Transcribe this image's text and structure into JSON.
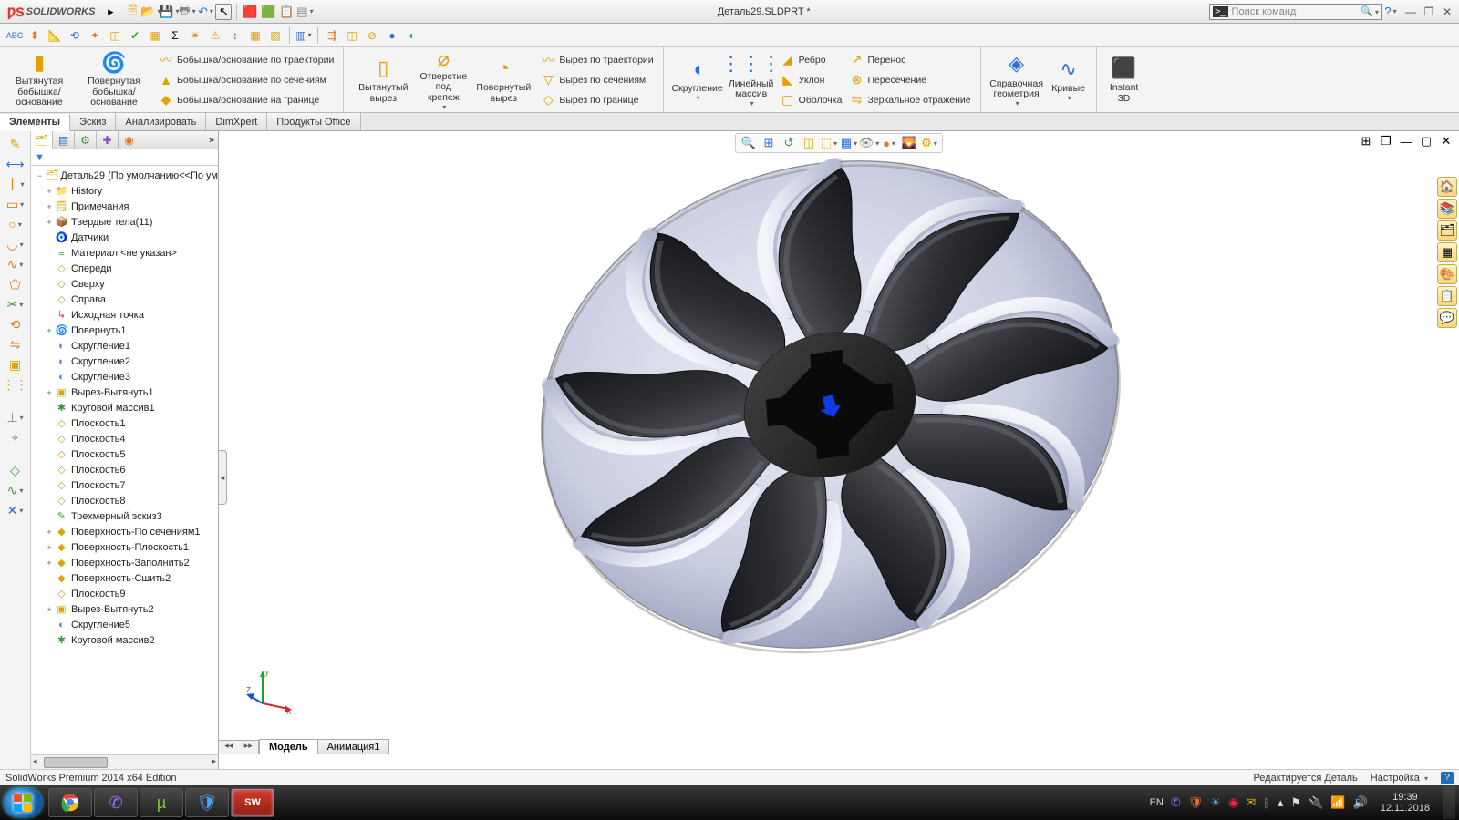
{
  "app": {
    "brand": "SOLIDWORKS",
    "document_title": "Деталь29.SLDPRT *",
    "search_placeholder": "Поиск команд"
  },
  "ribbon": {
    "big": {
      "extrude_boss": "Вытянутая\nбобышка/основание",
      "revolve_boss": "Повернутая\nбобышка/основание",
      "extrude_cut": "Вытянутый\nвырез",
      "hole": "Отверстие\nпод\nкрепеж",
      "revolve_cut": "Повернутый\nвырез",
      "fillet": "Скругление",
      "lpattern": "Линейный\nмассив",
      "ref_geom": "Справочная\nгеометрия",
      "curves": "Кривые",
      "instant3d": "Instant\n3D"
    },
    "boss_col": {
      "swept": "Бобышка/основание по траектории",
      "loft": "Бобышка/основание по сечениям",
      "boundary": "Бобышка/основание на границе"
    },
    "cut_col": {
      "swept": "Вырез по траектории",
      "loft": "Вырез по сечениям",
      "boundary": "Вырез по границе"
    },
    "feat_col": {
      "rib": "Ребро",
      "draft": "Уклон",
      "shell": "Оболочка"
    },
    "feat_col2": {
      "move": "Перенос",
      "intersect": "Пересечение",
      "mirror": "Зеркальное отражение"
    }
  },
  "tabs": {
    "list": [
      "Элементы",
      "Эскиз",
      "Анализировать",
      "DimXpert",
      "Продукты Office"
    ],
    "active": 0
  },
  "tree": {
    "root": "Деталь29  (По умолчанию<<По ум",
    "nodes": [
      {
        "exp": "+",
        "ico": "📁",
        "col": "c-b",
        "label": "History"
      },
      {
        "exp": "+",
        "ico": "🗒",
        "col": "c-y",
        "label": "Примечания"
      },
      {
        "exp": "+",
        "ico": "📦",
        "col": "c-y",
        "label": "Твердые тела(11)"
      },
      {
        "exp": "",
        "ico": "🧿",
        "col": "c-gr",
        "label": "Датчики"
      },
      {
        "exp": "",
        "ico": "≡",
        "col": "c-g",
        "label": "Материал <не указан>"
      },
      {
        "exp": "",
        "ico": "◇",
        "col": "c-plane",
        "label": "Спереди"
      },
      {
        "exp": "",
        "ico": "◇",
        "col": "c-plane",
        "label": "Сверху"
      },
      {
        "exp": "",
        "ico": "◇",
        "col": "c-plane",
        "label": "Справа"
      },
      {
        "exp": "",
        "ico": "↳",
        "col": "c-r",
        "label": "Исходная точка"
      },
      {
        "exp": "+",
        "ico": "🌀",
        "col": "c-feat",
        "label": "Повернуть1"
      },
      {
        "exp": "",
        "ico": "◐",
        "col": "c-feat",
        "label": "Скругление1"
      },
      {
        "exp": "",
        "ico": "◐",
        "col": "c-feat",
        "label": "Скругление2"
      },
      {
        "exp": "",
        "ico": "◐",
        "col": "c-feat",
        "label": "Скругление3"
      },
      {
        "exp": "+",
        "ico": "▣",
        "col": "c-y",
        "label": "Вырез-Вытянуть1"
      },
      {
        "exp": "",
        "ico": "✱",
        "col": "c-patt",
        "label": "Круговой массив1"
      },
      {
        "exp": "",
        "ico": "◇",
        "col": "c-plane",
        "label": "Плоскость1"
      },
      {
        "exp": "",
        "ico": "◇",
        "col": "c-plane",
        "label": "Плоскость4"
      },
      {
        "exp": "",
        "ico": "◇",
        "col": "c-plane",
        "label": "Плоскость5"
      },
      {
        "exp": "",
        "ico": "◇",
        "col": "c-plane",
        "label": "Плоскость6"
      },
      {
        "exp": "",
        "ico": "◇",
        "col": "c-plane",
        "label": "Плоскость7"
      },
      {
        "exp": "",
        "ico": "◇",
        "col": "c-plane",
        "label": "Плоскость8"
      },
      {
        "exp": "",
        "ico": "✎",
        "col": "c-g",
        "label": "Трехмерный эскиз3"
      },
      {
        "exp": "+",
        "ico": "◆",
        "col": "c-y",
        "label": "Поверхность-По сечениям1"
      },
      {
        "exp": "+",
        "ico": "◆",
        "col": "c-y",
        "label": "Поверхность-Плоскость1"
      },
      {
        "exp": "+",
        "ico": "◆",
        "col": "c-y",
        "label": "Поверхность-Заполнить2"
      },
      {
        "exp": "",
        "ico": "◆",
        "col": "c-y",
        "label": "Поверхность-Сшить2"
      },
      {
        "exp": "",
        "ico": "◇",
        "col": "c-plane",
        "label": "Плоскость9"
      },
      {
        "exp": "+",
        "ico": "▣",
        "col": "c-y",
        "label": "Вырез-Вытянуть2"
      },
      {
        "exp": "",
        "ico": "◐",
        "col": "c-feat",
        "label": "Скругление5"
      },
      {
        "exp": "",
        "ico": "✱",
        "col": "c-patt",
        "label": "Круговой массив2"
      }
    ]
  },
  "bottom_tabs": {
    "list": [
      "Модель",
      "Анимация1"
    ],
    "active": 0
  },
  "status": {
    "left": "SolidWorks Premium 2014 x64 Edition",
    "edit": "Редактируется Деталь",
    "custom": "Настройка"
  },
  "taskbar": {
    "lang": "EN",
    "time": "19:39",
    "date": "12.11.2018"
  },
  "triad": {
    "x": "X",
    "y": "Y",
    "z": "Z"
  }
}
